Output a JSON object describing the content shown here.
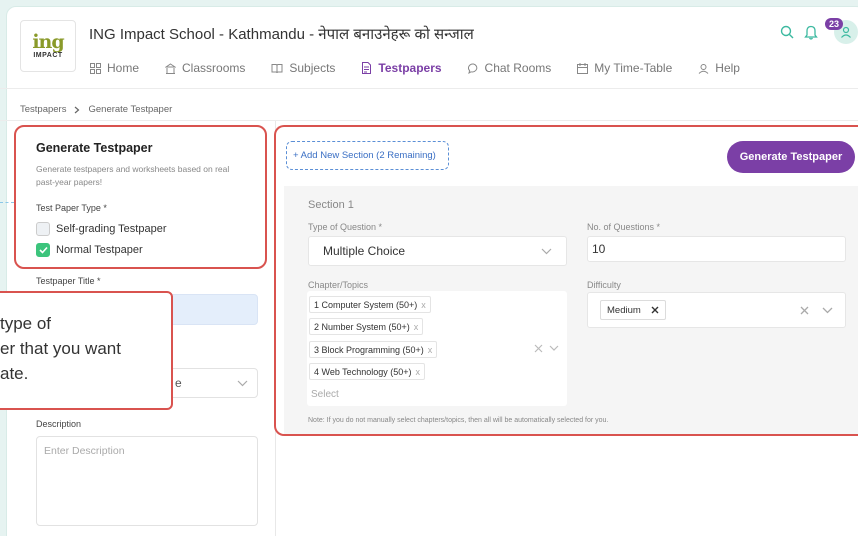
{
  "app": {
    "logo_text": "ing",
    "logo_sub": "IMPACT",
    "school_title": "ING Impact School - Kathmandu - नेपाल बनाउनेहरू को सन्जाल",
    "notification_count": "23"
  },
  "nav": [
    {
      "label": "Home",
      "icon": "home-grid-icon"
    },
    {
      "label": "Classrooms",
      "icon": "classroom-icon"
    },
    {
      "label": "Subjects",
      "icon": "book-icon"
    },
    {
      "label": "Testpapers",
      "icon": "testpaper-icon",
      "active": true
    },
    {
      "label": "Chat Rooms",
      "icon": "chat-icon"
    },
    {
      "label": "My Time-Table",
      "icon": "calendar-icon"
    },
    {
      "label": "Help",
      "icon": "help-icon"
    }
  ],
  "breadcrumb": {
    "root": "Testpapers",
    "current": "Generate Testpaper"
  },
  "sidebar": {
    "title": "Generate Testpaper",
    "description": "Generate testpapers and worksheets based on real past-year papers!",
    "type_label": "Test Paper Type *",
    "type_options": [
      {
        "label": "Self-grading Testpaper",
        "checked": false
      },
      {
        "label": "Normal Testpaper",
        "checked": true
      }
    ],
    "title_label": "Testpaper Title *",
    "description_label": "Description",
    "description_placeholder": "Enter Description"
  },
  "tooltip": {
    "line1": "type of",
    "line2": "er that you want",
    "line3": "ate.",
    "select_fragment": "e"
  },
  "main": {
    "add_section_label": "+ Add New Section  (2 Remaining)",
    "generate_button": "Generate Testpaper",
    "section": {
      "title": "Section 1",
      "type_label": "Type of Question *",
      "type_value": "Multiple Choice",
      "count_label": "No. of Questions *",
      "count_value": "10",
      "chapters_label": "Chapter/Topics",
      "chapters": [
        "1 Computer System (50+)",
        "2 Number System (50+)",
        "3 Block Programming (50+)",
        "4 Web Technology (50+)"
      ],
      "chapter_placeholder": "Select",
      "difficulty_label": "Difficulty",
      "difficulty_value": "Medium"
    },
    "note": "Note: If you do not manually select chapters/topics, then all will be automatically selected for you."
  },
  "colors": {
    "accent": "#7b3fa6",
    "highlight_box": "#d9534f",
    "checkbox_on": "#3cc47c",
    "link_blue": "#3a6fc4"
  }
}
